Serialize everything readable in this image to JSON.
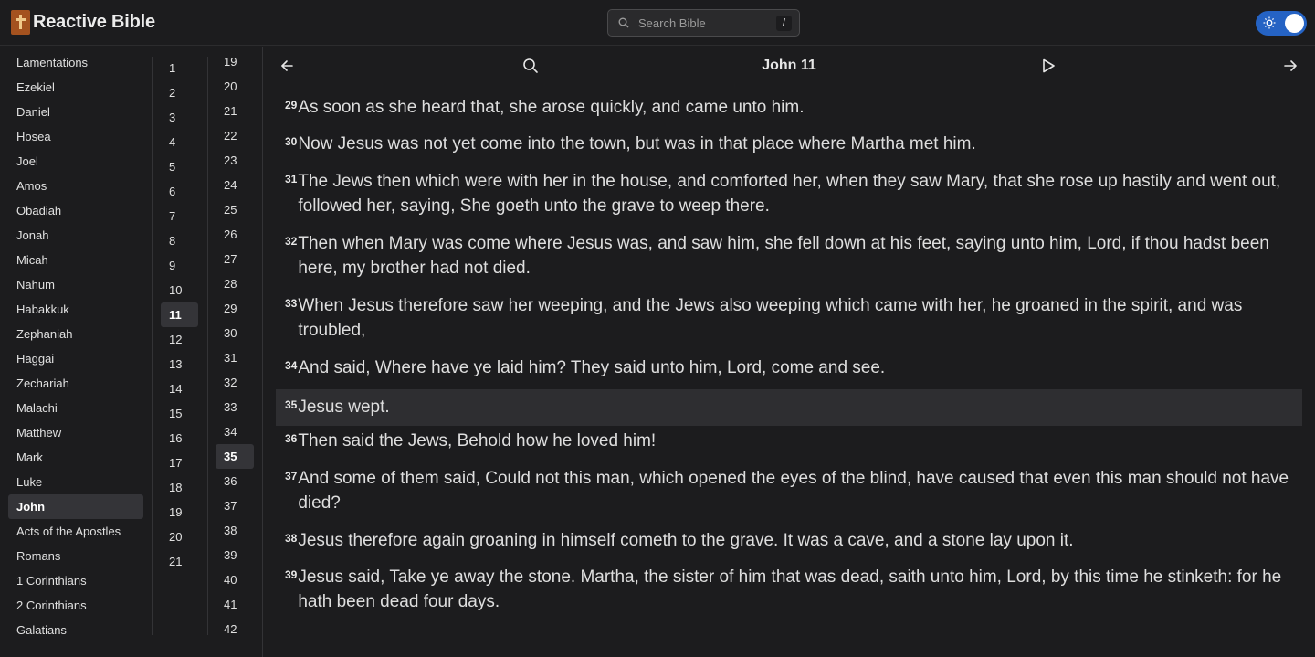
{
  "app": {
    "title": "Reactive Bible"
  },
  "search": {
    "placeholder": "Search Bible",
    "shortcut": "/"
  },
  "theme_toggle": {
    "mode": "dark",
    "accent": "#2563c4"
  },
  "books": [
    "Lamentations",
    "Ezekiel",
    "Daniel",
    "Hosea",
    "Joel",
    "Amos",
    "Obadiah",
    "Jonah",
    "Micah",
    "Nahum",
    "Habakkuk",
    "Zephaniah",
    "Haggai",
    "Zechariah",
    "Malachi",
    "Matthew",
    "Mark",
    "Luke",
    "John",
    "Acts of the Apostles",
    "Romans",
    "1 Corinthians",
    "2 Corinthians",
    "Galatians"
  ],
  "selected_book": "John",
  "chapters": [
    "1",
    "2",
    "3",
    "4",
    "5",
    "6",
    "7",
    "8",
    "9",
    "10",
    "11",
    "12",
    "13",
    "14",
    "15",
    "16",
    "17",
    "18",
    "19",
    "20",
    "21"
  ],
  "selected_chapter": "11",
  "verse_numbers": [
    "19",
    "20",
    "21",
    "22",
    "23",
    "24",
    "25",
    "26",
    "27",
    "28",
    "29",
    "30",
    "31",
    "32",
    "33",
    "34",
    "35",
    "36",
    "37",
    "38",
    "39",
    "40",
    "41",
    "42"
  ],
  "selected_verse": "35",
  "reader": {
    "title": "John 11",
    "verses": [
      {
        "num": "29",
        "text": "As soon as she heard that, she arose quickly, and came unto him."
      },
      {
        "num": "30",
        "text": "Now Jesus was not yet come into the town, but was in that place where Martha met him."
      },
      {
        "num": "31",
        "text": "The Jews then which were with her in the house, and comforted her, when they saw Mary, that she rose up hastily and went out, followed her, saying, She goeth unto the grave to weep there."
      },
      {
        "num": "32",
        "text": "Then when Mary was come where Jesus was, and saw him, she fell down at his feet, saying unto him, Lord, if thou hadst been here, my brother had not died."
      },
      {
        "num": "33",
        "text": "When Jesus therefore saw her weeping, and the Jews also weeping which came with her, he groaned in the spirit, and was troubled,"
      },
      {
        "num": "34",
        "text": "And said, Where have ye laid him? They said unto him, Lord, come and see."
      },
      {
        "num": "35",
        "text": "Jesus wept."
      },
      {
        "num": "36",
        "text": "Then said the Jews, Behold how he loved him!"
      },
      {
        "num": "37",
        "text": "And some of them said, Could not this man, which opened the eyes of the blind, have caused that even this man should not have died?"
      },
      {
        "num": "38",
        "text": "Jesus therefore again groaning in himself cometh to the grave. It was a cave, and a stone lay upon it."
      },
      {
        "num": "39",
        "text": "Jesus said, Take ye away the stone. Martha, the sister of him that was dead, saith unto him, Lord, by this time he stinketh: for he hath been dead four days."
      }
    ]
  }
}
